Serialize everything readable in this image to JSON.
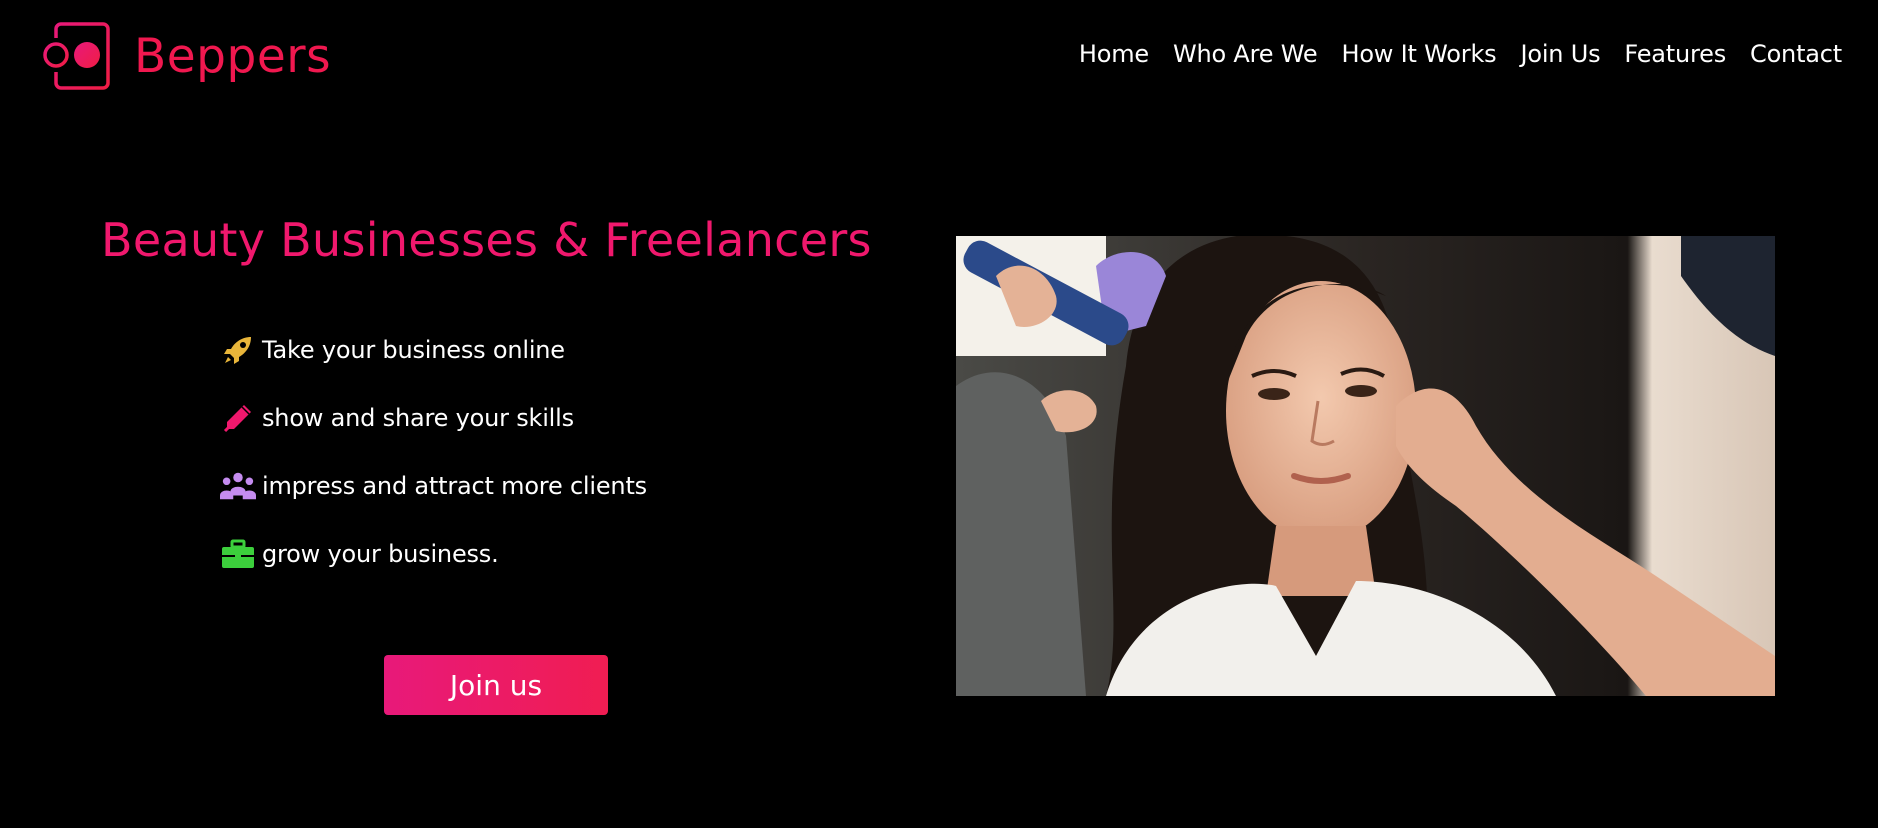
{
  "brand": {
    "name": "Beppers",
    "logo_icon": "beppers-logo-icon",
    "color": "#f0184f"
  },
  "nav": {
    "items": [
      {
        "label": "Home"
      },
      {
        "label": "Who Are We"
      },
      {
        "label": "How It Works"
      },
      {
        "label": "Join Us"
      },
      {
        "label": "Features"
      },
      {
        "label": "Contact"
      }
    ]
  },
  "hero": {
    "title": "Beauty Businesses & Freelancers",
    "title_color": "#f0186d",
    "features": [
      {
        "icon": "rocket-icon",
        "text": "Take your business online",
        "icon_color": "#e8b53a"
      },
      {
        "icon": "pen-icon",
        "text": "show and share your skills",
        "icon_color": "#f0186d"
      },
      {
        "icon": "users-icon",
        "text": "impress and attract more clients",
        "icon_color": "#c58cf0"
      },
      {
        "icon": "briefcase-icon",
        "text": "grow your business.",
        "icon_color": "#3ccf3c"
      }
    ],
    "cta_label": "Join us",
    "cta_color": "#f01d5e",
    "image_icon": "hairstylist-photo"
  }
}
